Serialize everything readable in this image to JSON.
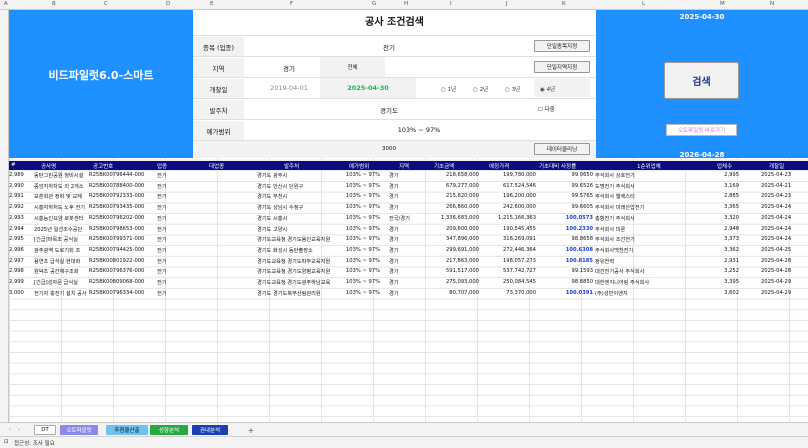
{
  "column_headers": [
    "A",
    "B",
    "C",
    "D",
    "E",
    "F",
    "G",
    "H",
    "I",
    "J",
    "K",
    "L",
    "M",
    "N"
  ],
  "left_panel": {
    "title": "비드파일럿6.0-스마트"
  },
  "right_panel": {
    "date_top": "2025-04-30",
    "date_bottom": "2026-04-28",
    "search_button": "검색",
    "reset_button": "오토파일럿 바로가기"
  },
  "form": {
    "title": "공사 조건검색",
    "labels": {
      "category": "종목 (업종)",
      "region": "지역",
      "opening": "개찰일",
      "client": "발주처",
      "range": "예가범위"
    },
    "category_value": "전기",
    "region_value": "경기",
    "region_all": "전체",
    "date_start": "2019-04-01",
    "date_end": "2025-04-30",
    "client_value": "경기도",
    "range_value": "103% ~ 97%",
    "count_value": "3000",
    "btn_category": "단일종목지정",
    "btn_region": "단일지역지정",
    "btn_data_clear": "데이터클리닝",
    "radios": [
      "1년",
      "2년",
      "3년",
      "4년"
    ],
    "radio_selected": "4년",
    "checkbox_label": "다중"
  },
  "table": {
    "headers": [
      "#",
      "공사명",
      "공고번호",
      "업종",
      "대업종",
      "발주처",
      "예가범위",
      "지역",
      "기초금액",
      "예정가격",
      "기초대비 사정률",
      "1순위업체",
      "업체수",
      "개찰일"
    ],
    "rows": [
      [
        "2,989",
        "동탄그린공원 청비시설",
        "R25BK00796444-000",
        "전기",
        "경기도 광주시",
        "103% ~ 97%",
        "경기",
        "218,658,000",
        "199,780,000",
        "99.0650",
        "주식회사 상호전기",
        "2,995",
        "2025-04-23"
      ],
      [
        "2,990",
        "중앙지하차도 외 2개소",
        "R25BK00788400-000",
        "전기",
        "경기도 안산시 단원구",
        "103% ~ 97%",
        "경기",
        "679,277,000",
        "617,524,546",
        "99.6526",
        "도명전기 주식회사",
        "3,169",
        "2025-04-21"
      ],
      [
        "2,991",
        "보훈회관 정비 및 교체",
        "R25BK00792333-000",
        "전기",
        "경기도 부천시",
        "103% ~ 97%",
        "경기",
        "215,820,000",
        "196,200,000",
        "99.5765",
        "주식회사 엘에스티",
        "2,885",
        "2025-04-23"
      ],
      [
        "2,992",
        "시흥자하처도 노후 전기",
        "R25BK00793435-000",
        "전기",
        "경기도 성남시 수정구",
        "103% ~ 97%",
        "경기",
        "266,860,000",
        "242,600,000",
        "99.6605",
        "주식회사 미래산업전기",
        "3,365",
        "2025-04-24"
      ],
      [
        "2,993",
        "시흥능인요양 로봇센터",
        "R25BK00796202-000",
        "전기",
        "경기도 시흥시",
        "103% ~ 97%",
        "전국/경기",
        "1,336,683,000",
        "1,215,166,363",
        "100.0573",
        "총항전기 주식회사",
        "3,320",
        "2025-04-24"
      ],
      [
        "2,994",
        "2025년 일선조수공단",
        "R25BK00798653-000",
        "전기",
        "경기도 고양시",
        "103% ~ 97%",
        "경기",
        "209,600,000",
        "190,545,455",
        "100.2330",
        "주식회사 미론",
        "2,948",
        "2025-04-24"
      ],
      [
        "2,995",
        "[긴급]마목조 공식실",
        "R25BK00799371-000",
        "전기",
        "경기도교육청 경기도용인교육지원",
        "103% ~ 97%",
        "경기",
        "347,896,000",
        "316,269,091",
        "98.8658",
        "주식회사 조선전기",
        "3,373",
        "2025-04-24"
      ],
      [
        "2,996",
        "광주광역 도로기회 조",
        "R25BK00794425-000",
        "전기",
        "경기도 화성시 동탄출장소",
        "103% ~ 97%",
        "경기",
        "299,691,000",
        "272,446,364",
        "100.6308",
        "주식회사백천전기",
        "3,362",
        "2025-04-25"
      ],
      [
        "2,997",
        "용연초 급식실 현대화",
        "R25BK00801922-000",
        "전기",
        "경기도교육청 경기도파주교육지원",
        "103% ~ 97%",
        "경기",
        "217,863,000",
        "198,057,273",
        "100.8185",
        "정유전력",
        "2,931",
        "2025-04-28"
      ],
      [
        "2,998",
        "원덕초 공간재구조화",
        "R25BK00796376-000",
        "전기",
        "경기도교육청 경기도양평교육지원",
        "103% ~ 97%",
        "경기",
        "591,517,000",
        "537,742,727",
        "99.1593",
        "대건전기공사 주식회사",
        "3,252",
        "2025-04-28"
      ],
      [
        "2,999",
        "[긴급]성자문 급식실",
        "R25BK00809068-000",
        "전기",
        "경기도교육청 경기도광주하남교육",
        "103% ~ 97%",
        "경기",
        "275,093,000",
        "250,084,545",
        "98.8850",
        "대한엔지니어링 주식회사",
        "3,395",
        "2025-04-29"
      ],
      [
        "3,000",
        "전기차 충전기 설치 공사",
        "R25BK00796334-000",
        "전기",
        "경기도 경기도북부산림관리원",
        "103% ~ 97%",
        "경기",
        "80,707,000",
        "73,370,000",
        "100.0391",
        "(주)성민이엔지",
        "3,602",
        "2025-04-29"
      ]
    ],
    "highlight_threshold": 100
  },
  "tabs": [
    "DT",
    "오토파일럿",
    "추첨율산출",
    "성향분석",
    "권내분석"
  ],
  "tab_colors": {
    "DT": "#ffffff",
    "오토파일럿": "#8a8ae6",
    "추첨율산출": "#6ec2f0",
    "성향분석": "#28a745",
    "권내분석": "#1b3fb0"
  },
  "status": {
    "text": "접근성: 조사 필요"
  }
}
